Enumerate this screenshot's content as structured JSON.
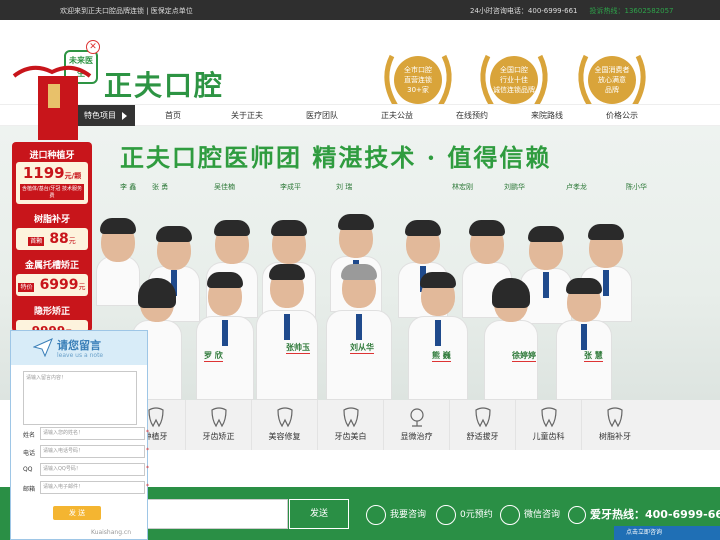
{
  "topbar": {
    "welcome": "欢迎来到正夫口腔品牌连锁 | 医保定点单位",
    "consult": "24小时咨询电话：400-6999-661",
    "complaint": "投诉热线：13602582057"
  },
  "header": {
    "logo_mark": "未来医生",
    "logo_text": "正夫口腔",
    "awards": [
      {
        "line1": "全市口腔",
        "line2": "直营连锁",
        "line3": "30+家"
      },
      {
        "line1": "全国口腔",
        "line2": "行业十佳",
        "line3": "诚信连锁品牌"
      },
      {
        "line1": "全国消费者",
        "line2": "放心满意",
        "line3": "品牌"
      }
    ]
  },
  "nav": {
    "first": "特色项目",
    "items": [
      "首页",
      "关于正夫",
      "医疗团队",
      "正夫公益",
      "在线预约",
      "来院路线",
      "价格公示"
    ]
  },
  "banner": {
    "title": "正夫口腔医师团   精湛技术 · 值得信赖",
    "top_names": [
      "李  鑫",
      "张  勇",
      "吴佳楠",
      "李成平",
      "刘  瑞",
      "林宏刚",
      "刘鹏华",
      "卢孝龙",
      "陈小华"
    ],
    "bottom_names": [
      "罗  欣",
      "张帅玉",
      "刘从华",
      "熊  巍",
      "徐婷婷",
      "张  慧"
    ]
  },
  "promo": {
    "items": [
      {
        "title": "进口种植牙",
        "price": "1199",
        "unit": "元/颗",
        "note": "含植体/基台/牙冠 技术服务费"
      },
      {
        "title": "树脂补牙",
        "tag": "首颗",
        "price": "88",
        "unit": "元"
      },
      {
        "title": "金属托槽矫正",
        "tag": "特价",
        "price": "6999",
        "unit": "元"
      },
      {
        "title": "隐形矫正",
        "price": "9999",
        "unit": "元"
      }
    ],
    "gift_label": "正夫口腔"
  },
  "services": [
    "种植牙",
    "牙齿矫正",
    "美容修复",
    "牙齿美白",
    "显微治疗",
    "舒适拔牙",
    "儿童齿科",
    "树脂补牙"
  ],
  "services_first": "种植牙",
  "message": {
    "title": "请您留言",
    "subtitle": "leave us a note",
    "content_placeholder": "请输入留言内容！",
    "fields": [
      {
        "label": "姓名",
        "placeholder": "请输入您的姓名！"
      },
      {
        "label": "电话",
        "placeholder": "请输入电话号码！"
      },
      {
        "label": "QQ",
        "placeholder": "请输入QQ号码！"
      },
      {
        "label": "邮箱",
        "placeholder": "请输入电子邮件！"
      }
    ],
    "submit": "发 送",
    "footer": "Kuaishang.cn"
  },
  "bottom": {
    "send": "发送",
    "items": [
      "我要咨询",
      "0元预约",
      "微信咨询"
    ],
    "hotline": "爱牙热线：400-6999-661"
  },
  "chat_button": "点击立即咨询"
}
